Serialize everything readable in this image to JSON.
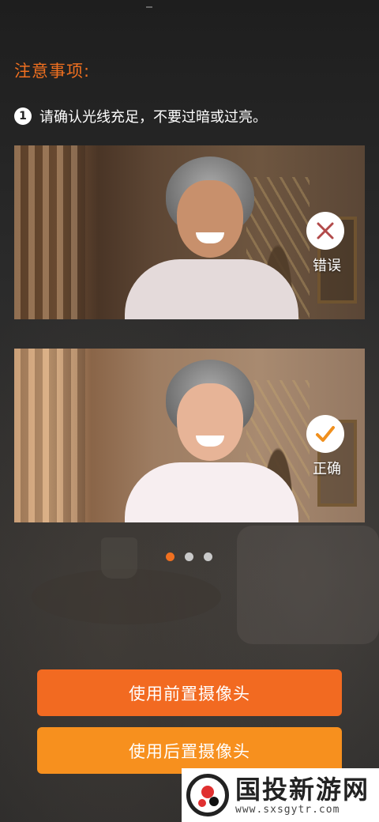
{
  "notice": {
    "title": "注意事项:",
    "tip_number": "1",
    "tip_text": "请确认光线充足，不要过暗或过亮。"
  },
  "examples": [
    {
      "label": "错误",
      "icon": "cross-icon",
      "accent": "#b24a4a"
    },
    {
      "label": "正确",
      "icon": "check-icon",
      "accent": "#f0901e"
    }
  ],
  "pager": {
    "count": 3,
    "active_index": 0
  },
  "buttons": {
    "front_camera": "使用前置摄像头",
    "rear_camera": "使用后置摄像头"
  },
  "watermark": {
    "title": "国投新游网",
    "url": "www.sxsgytr.com"
  },
  "colors": {
    "accent": "#f07020",
    "front_button": "#f26a21",
    "rear_button": "#f7901e"
  }
}
